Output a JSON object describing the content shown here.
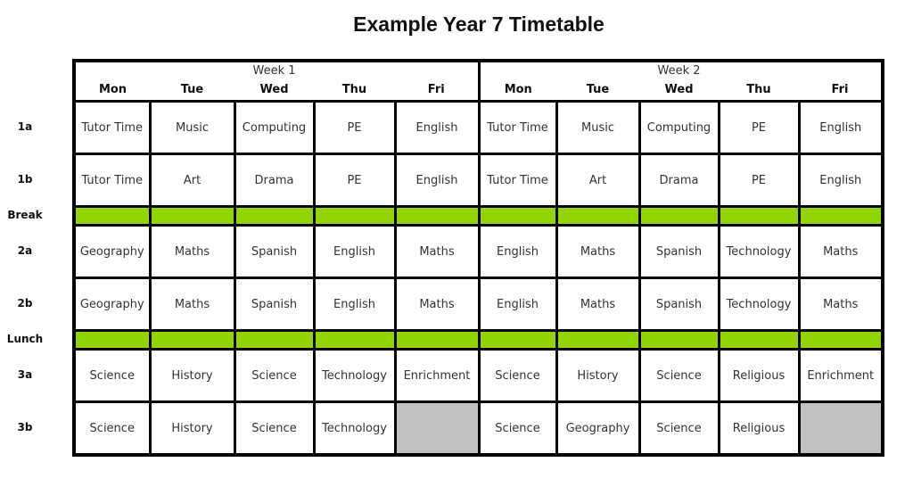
{
  "title": "Example Year 7 Timetable",
  "weeks": [
    {
      "label": "Week 1",
      "days": [
        "Mon",
        "Tue",
        "Wed",
        "Thu",
        "Fri"
      ]
    },
    {
      "label": "Week 2",
      "days": [
        "Mon",
        "Tue",
        "Wed",
        "Thu",
        "Fri"
      ]
    }
  ],
  "colors": {
    "break_fill": "#92d400",
    "empty_fill": "#c0c0c0",
    "border": "#000000"
  },
  "rows": [
    {
      "label": "1a",
      "type": "lesson",
      "cells": [
        "Tutor Time",
        "Music",
        "Computing",
        "PE",
        "English",
        "Tutor Time",
        "Music",
        "Computing",
        "PE",
        "English"
      ]
    },
    {
      "label": "1b",
      "type": "lesson",
      "cells": [
        "Tutor Time",
        "Art",
        "Drama",
        "PE",
        "English",
        "Tutor Time",
        "Art",
        "Drama",
        "PE",
        "English"
      ]
    },
    {
      "label": "Break",
      "type": "break",
      "cells": [
        "",
        "",
        "",
        "",
        "",
        "",
        "",
        "",
        "",
        ""
      ]
    },
    {
      "label": "2a",
      "type": "lesson",
      "cells": [
        "Geography",
        "Maths",
        "Spanish",
        "English",
        "Maths",
        "English",
        "Maths",
        "Spanish",
        "Technology",
        "Maths"
      ]
    },
    {
      "label": "2b",
      "type": "lesson",
      "cells": [
        "Geography",
        "Maths",
        "Spanish",
        "English",
        "Maths",
        "English",
        "Maths",
        "Spanish",
        "Technology",
        "Maths"
      ]
    },
    {
      "label": "Lunch",
      "type": "break",
      "cells": [
        "",
        "",
        "",
        "",
        "",
        "",
        "",
        "",
        "",
        ""
      ]
    },
    {
      "label": "3a",
      "type": "lesson",
      "cells": [
        "Science",
        "History",
        "Science",
        "Technology",
        "Enrichment",
        "Science",
        "History",
        "Science",
        "Religious",
        "Enrichment"
      ]
    },
    {
      "label": "3b",
      "type": "lesson",
      "cells": [
        "Science",
        "History",
        "Science",
        "Technology",
        null,
        "Science",
        "Geography",
        "Science",
        "Religious",
        null
      ]
    }
  ]
}
